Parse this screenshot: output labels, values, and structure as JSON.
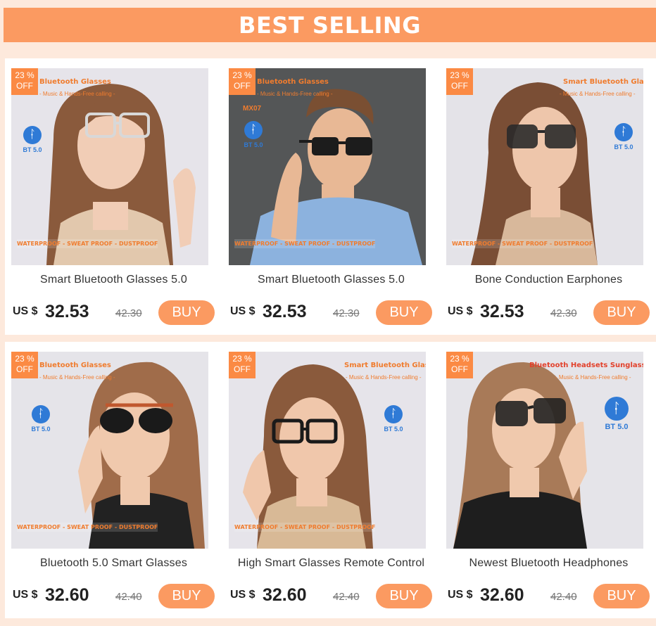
{
  "banner": {
    "title": "BEST SELLING"
  },
  "colors": {
    "accent": "#fb9a61",
    "discount": "#fb8a44",
    "bluetooth": "#2f7ad6"
  },
  "products": [
    {
      "name": "Smart Bluetooth Glasses 5.0",
      "currency": "US $",
      "price": "32.53",
      "old_price": "42.30",
      "buy_label": "BUY",
      "discount_num": "23",
      "discount_pct": "%",
      "discount_label": "OFF",
      "promo_title": "Bluetooth Glasses",
      "promo_sub": "- Music & Hands-Free calling -",
      "bt_label": "BT 5.0",
      "bt_icon": "bluetooth-icon",
      "strip": "WATERPROOF - SWEAT PROOF - DUSTPROOF"
    },
    {
      "name": "Smart Bluetooth Glasses 5.0",
      "currency": "US $",
      "price": "32.53",
      "old_price": "42.30",
      "buy_label": "BUY",
      "discount_num": "23",
      "discount_pct": "%",
      "discount_label": "OFF",
      "promo_title": "Bluetooth Glasses",
      "promo_sub": "- Music & Hands-Free calling -",
      "model": "MX07",
      "bt_label": "BT 5.0",
      "bt_icon": "bluetooth-icon",
      "strip": "WATERPROOF - SWEAT PROOF - DUSTPROOF"
    },
    {
      "name": "Bone Conduction Earphones",
      "currency": "US $",
      "price": "32.53",
      "old_price": "42.30",
      "buy_label": "BUY",
      "discount_num": "23",
      "discount_pct": "%",
      "discount_label": "OFF",
      "promo_title": "Smart Bluetooth Glasses",
      "promo_sub": "- Music & Hands-Free calling -",
      "bt_label": "BT 5.0",
      "bt_icon": "bluetooth-icon",
      "strip": "WATERPROOF - SWEAT PROOF - DUSTPROOF"
    },
    {
      "name": "Bluetooth 5.0 Smart Glasses",
      "currency": "US $",
      "price": "32.60",
      "old_price": "42.40",
      "buy_label": "BUY",
      "discount_num": "23",
      "discount_pct": "%",
      "discount_label": "OFF",
      "promo_title": "Bluetooth Glasses",
      "promo_sub": "- Music & Hands-Free calling -",
      "bt_label": "BT 5.0",
      "bt_icon": "bluetooth-icon",
      "strip": "WATERPROOF - SWEAT PROOF - DUSTPROOF"
    },
    {
      "name": "High Smart Glasses Remote Control",
      "currency": "US $",
      "price": "32.60",
      "old_price": "42.40",
      "buy_label": "BUY",
      "discount_num": "23",
      "discount_pct": "%",
      "discount_label": "OFF",
      "promo_title": "Smart Bluetooth Glasses",
      "promo_sub": "- Music & Hands-Free calling -",
      "bt_label": "BT 5.0",
      "bt_icon": "bluetooth-icon",
      "strip": "WATERPROOF - SWEAT PROOF - DUSTPROOF"
    },
    {
      "name": "Newest Bluetooth Headphones",
      "currency": "US $",
      "price": "32.60",
      "old_price": "42.40",
      "buy_label": "BUY",
      "discount_num": "23",
      "discount_pct": "%",
      "discount_label": "OFF",
      "promo_title": "Bluetooth Headsets Sunglasses",
      "promo_sub": "- Music & Hands-Free calling -",
      "bt_label": "BT 5.0",
      "bt_icon": "bluetooth-icon"
    }
  ]
}
